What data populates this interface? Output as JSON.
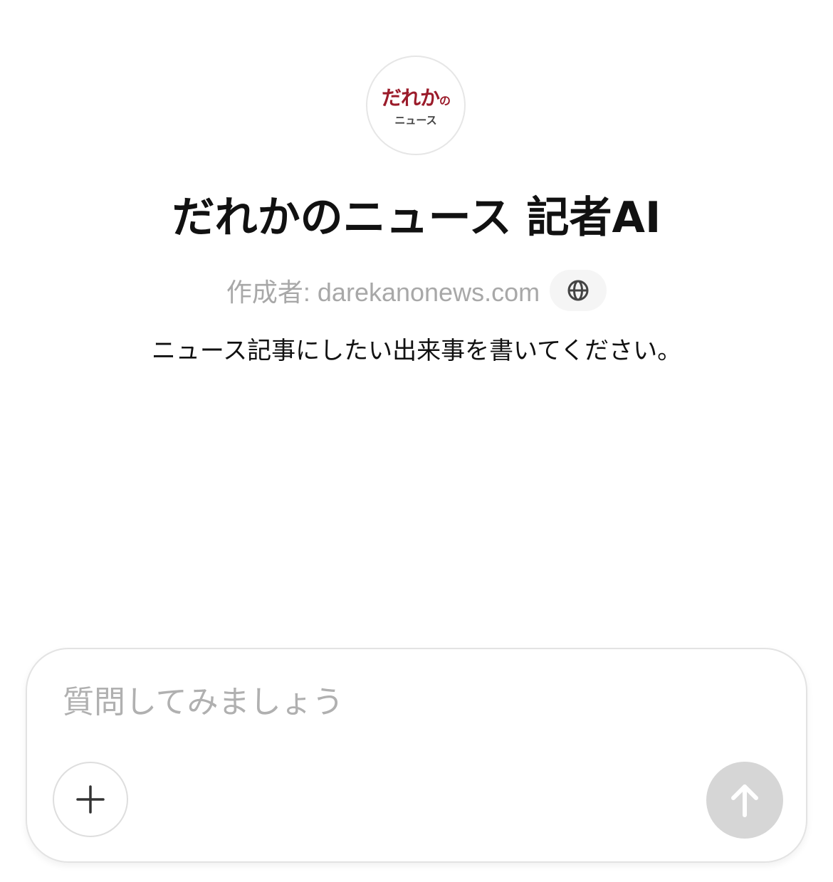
{
  "logo": {
    "top_text": "だれか",
    "top_text_small": "の",
    "bottom_text": "ニュース"
  },
  "title": "だれかのニュース 記者AI",
  "author": "作成者: darekanonews.com",
  "description": "ニュース記事にしたい出来事を書いてください。",
  "composer": {
    "placeholder": "質問してみましょう"
  },
  "icons": {
    "globe": "globe-icon",
    "plus": "plus-icon",
    "send": "arrow-up-icon"
  },
  "colors": {
    "logo_accent": "#9b1b2a",
    "send_disabled": "#d6d6d6"
  }
}
